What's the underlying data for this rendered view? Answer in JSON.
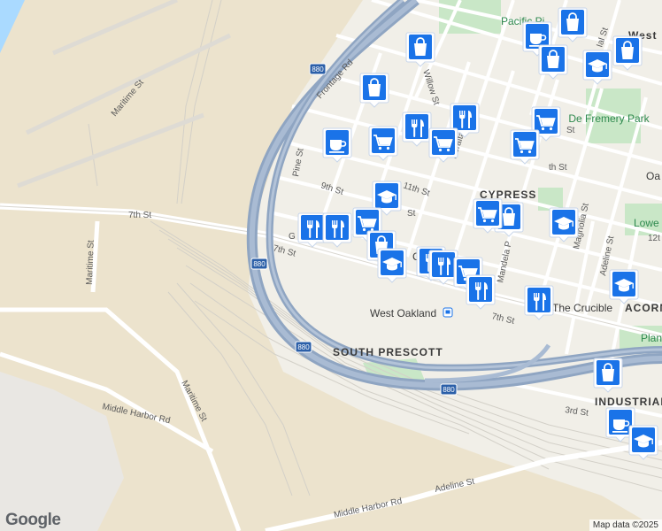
{
  "map": {
    "logo": "Google",
    "attribution": "Map data ©2025",
    "highway_shield": "880",
    "neighborhoods": [
      "SOUTH PRESCOTT",
      "CYPRESS",
      "INDUSTRIAL",
      "ACORN"
    ],
    "places": [
      "West Oakland",
      "The Crucible"
    ],
    "parks": [
      "De Fremery Park",
      "Pacific Pi",
      "Plan",
      "Lowe"
    ],
    "streets": [
      "Maritime St",
      "Maritime St",
      "Maritime St",
      "7th St",
      "7th St",
      "7th St",
      "Frontage Rd",
      "Middle Harbor Rd",
      "Middle Harbor Rd",
      "Adeline St",
      "Adeline St",
      "Pine St",
      "9th St",
      "11th St",
      "Peralta St",
      "Willow St",
      "3rd St",
      "Magnolia St",
      "Mandela P",
      "12t",
      "Oa",
      "West",
      "St",
      "St",
      "G",
      "C",
      "Ial St",
      "th St"
    ],
    "pins": [
      {
        "icon": "shopping-bag-icon"
      },
      {
        "icon": "coffee-cup-icon"
      },
      {
        "icon": "shopping-bag-icon"
      },
      {
        "icon": "shopping-bag-icon"
      },
      {
        "icon": "graduation-cap-icon"
      },
      {
        "icon": "shopping-bag-icon"
      },
      {
        "icon": "shopping-bag-icon"
      },
      {
        "icon": "restaurant-icon"
      },
      {
        "icon": "restaurant-icon"
      },
      {
        "icon": "shopping-cart-icon"
      },
      {
        "icon": "shopping-cart-icon"
      },
      {
        "icon": "coffee-cup-icon"
      },
      {
        "icon": "shopping-cart-icon"
      },
      {
        "icon": "shopping-cart-icon"
      },
      {
        "icon": "graduation-cap-icon"
      },
      {
        "icon": "shopping-cart-icon"
      },
      {
        "icon": "shopping-bag-icon"
      },
      {
        "icon": "graduation-cap-icon"
      },
      {
        "icon": "restaurant-icon"
      },
      {
        "icon": "restaurant-icon"
      },
      {
        "icon": "shopping-cart-icon"
      },
      {
        "icon": "shopping-bag-icon"
      },
      {
        "icon": "graduation-cap-icon"
      },
      {
        "icon": "restaurant-icon"
      },
      {
        "icon": "restaurant-icon"
      },
      {
        "icon": "shopping-cart-icon"
      },
      {
        "icon": "restaurant-icon"
      },
      {
        "icon": "graduation-cap-icon"
      },
      {
        "icon": "restaurant-icon"
      },
      {
        "icon": "shopping-bag-icon"
      },
      {
        "icon": "coffee-cup-icon"
      },
      {
        "icon": "graduation-cap-icon"
      }
    ],
    "colors": {
      "land": "#f2efe9",
      "port": "#ebe3cf",
      "water": "#aadaff",
      "park": "#c8e6c9",
      "highway": "#8ea6c4",
      "street": "#ffffff",
      "pin": "#1a73e8"
    }
  }
}
